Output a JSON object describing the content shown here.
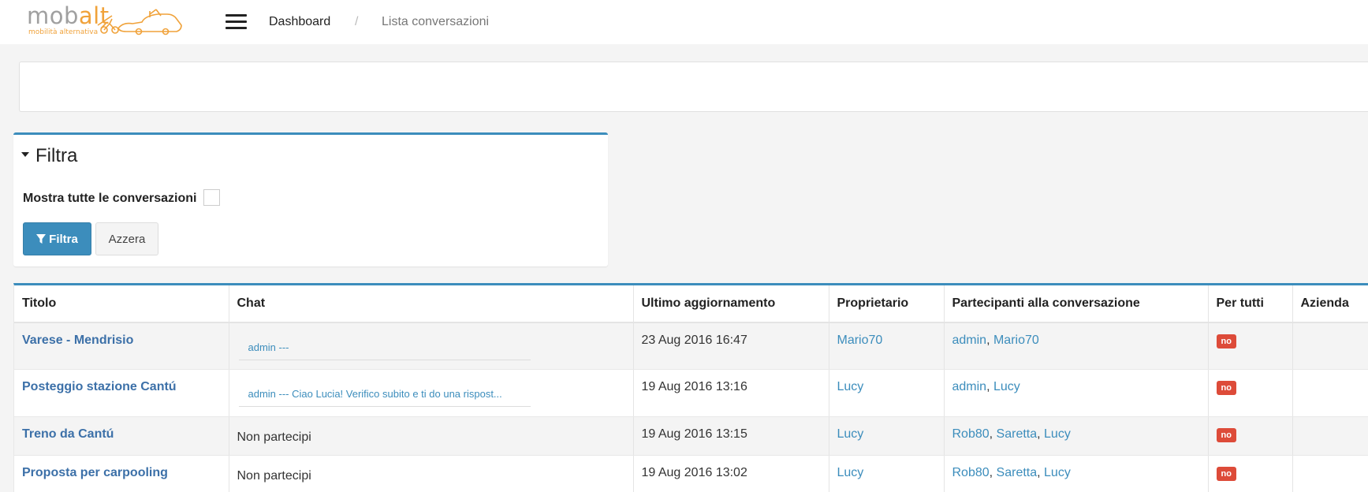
{
  "header": {
    "logo_text_main": "mob",
    "logo_text_accent": "alt",
    "logo_tagline": "mobilità alternativa",
    "breadcrumb": {
      "home": "Dashboard",
      "separator": "/",
      "current": "Lista conversazioni"
    }
  },
  "filter": {
    "title": "Filtra",
    "show_all_label": "Mostra tutte le conversazioni",
    "show_all_checked": false,
    "filter_button": "Filtra",
    "reset_button": "Azzera"
  },
  "table": {
    "columns": [
      "Titolo",
      "Chat",
      "Ultimo aggiornamento",
      "Proprietario",
      "Partecipanti alla conversazione",
      "Per tutti",
      "Azienda"
    ],
    "rows": [
      {
        "title": "Varese - Mendrisio",
        "chat": "admin ---",
        "chat_is_link": true,
        "updated": "23 Aug 2016 16:47",
        "owner": "Mario70",
        "participants": [
          "admin",
          "Mario70"
        ],
        "for_all": "no",
        "company": ""
      },
      {
        "title": "Posteggio stazione Cantú",
        "chat": "admin --- Ciao Lucia! Verifico subito e ti do una rispost...",
        "chat_is_link": true,
        "updated": "19 Aug 2016 13:16",
        "owner": "Lucy",
        "participants": [
          "admin",
          "Lucy"
        ],
        "for_all": "no",
        "company": ""
      },
      {
        "title": "Treno da Cantú",
        "chat": "Non partecipi",
        "chat_is_link": false,
        "updated": "19 Aug 2016 13:15",
        "owner": "Lucy",
        "participants": [
          "Rob80",
          "Saretta",
          "Lucy"
        ],
        "for_all": "no",
        "company": ""
      },
      {
        "title": "Proposta per carpooling",
        "chat": "Non partecipi",
        "chat_is_link": false,
        "updated": "19 Aug 2016 13:02",
        "owner": "Lucy",
        "participants": [
          "Rob80",
          "Saretta",
          "Lucy"
        ],
        "for_all": "no",
        "company": ""
      }
    ]
  },
  "colors": {
    "primary": "#3c8dbc",
    "link": "#3c8dbc",
    "danger_badge": "#dd4b39",
    "logo_orange": "#f0a23a"
  },
  "icons": [
    "hamburger-menu-icon",
    "caret-down-icon",
    "filter-icon",
    "logo-car-bike-icon"
  ]
}
